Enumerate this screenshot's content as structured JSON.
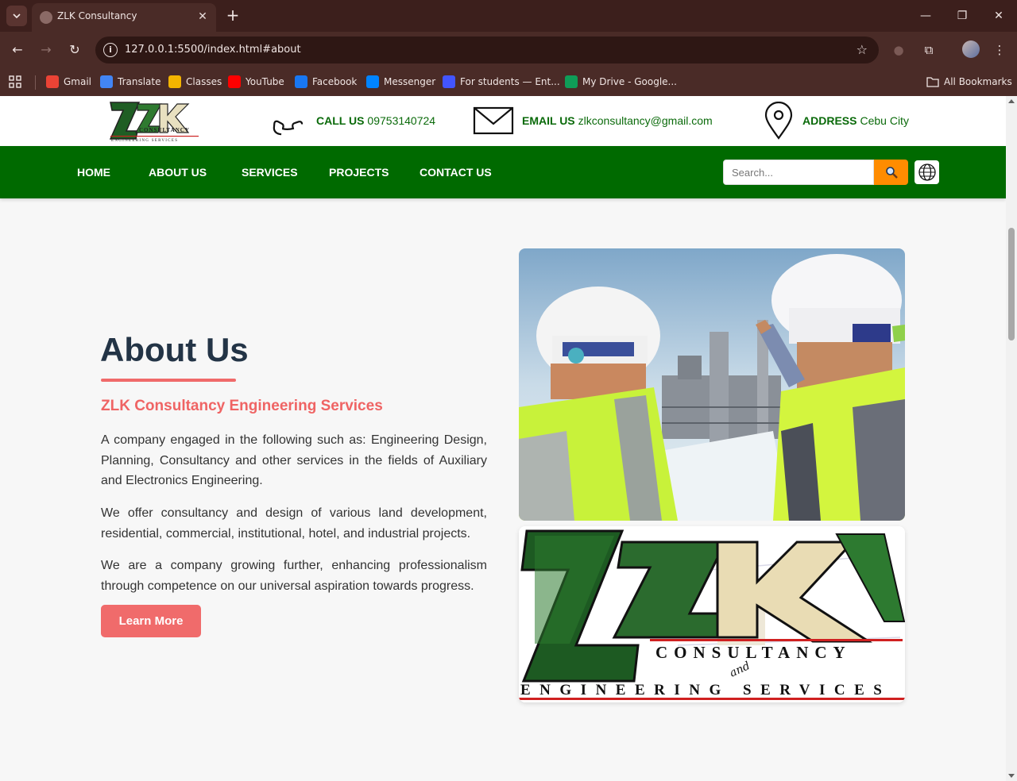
{
  "browser": {
    "tab_title": "ZLK Consultancy",
    "url": "127.0.0.1:5500/index.html#about",
    "bookmarks": [
      {
        "label": "Gmail",
        "icon": "gmail-icon",
        "color": "#ea4335"
      },
      {
        "label": "Translate",
        "icon": "translate-icon",
        "color": "#4285f4"
      },
      {
        "label": "Classes",
        "icon": "classroom-icon",
        "color": "#f4b400"
      },
      {
        "label": "YouTube",
        "icon": "youtube-icon",
        "color": "#ff0000"
      },
      {
        "label": "Facebook",
        "icon": "facebook-icon",
        "color": "#1877f2"
      },
      {
        "label": "Messenger",
        "icon": "messenger-icon",
        "color": "#0084ff"
      },
      {
        "label": "For students — Ent...",
        "icon": "quizlet-icon",
        "color": "#4255ff"
      },
      {
        "label": "My Drive - Google...",
        "icon": "drive-icon",
        "color": "#0f9d58"
      }
    ],
    "all_bookmarks": "All Bookmarks"
  },
  "header": {
    "call_label": "CALL US",
    "call_value": "09753140724",
    "email_label": "EMAIL US",
    "email_value": "zlkconsultancy@gmail.com",
    "address_label": "ADDRESS",
    "address_value": "Cebu City"
  },
  "nav": {
    "items": [
      "HOME",
      "ABOUT US",
      "SERVICES",
      "PROJECTS",
      "CONTACT US"
    ],
    "search_placeholder": "Search..."
  },
  "about": {
    "title": "About Us",
    "subtitle": "ZLK Consultancy Engineering Services",
    "paragraphs": [
      "A company engaged in the following such as: Engineering Design, Planning, Consultancy and other services in the fields of Auxiliary and Electronics Engineering.",
      "We offer consultancy and design of various land development, residential, commercial, institutional, hotel, and industrial projects.",
      "We are a company growing further, enhancing professionalism through competence on our universal aspiration towards progress."
    ],
    "button": "Learn More"
  },
  "logo": {
    "letters": "ZLK",
    "line1": "CONSULTANCY",
    "line2": "ENGINEERING SERVICES",
    "and": "and"
  },
  "colors": {
    "nav_green": "#006a00",
    "accent_coral": "#f06b6b",
    "search_orange": "#ff8c00",
    "heading_navy": "#233446"
  }
}
